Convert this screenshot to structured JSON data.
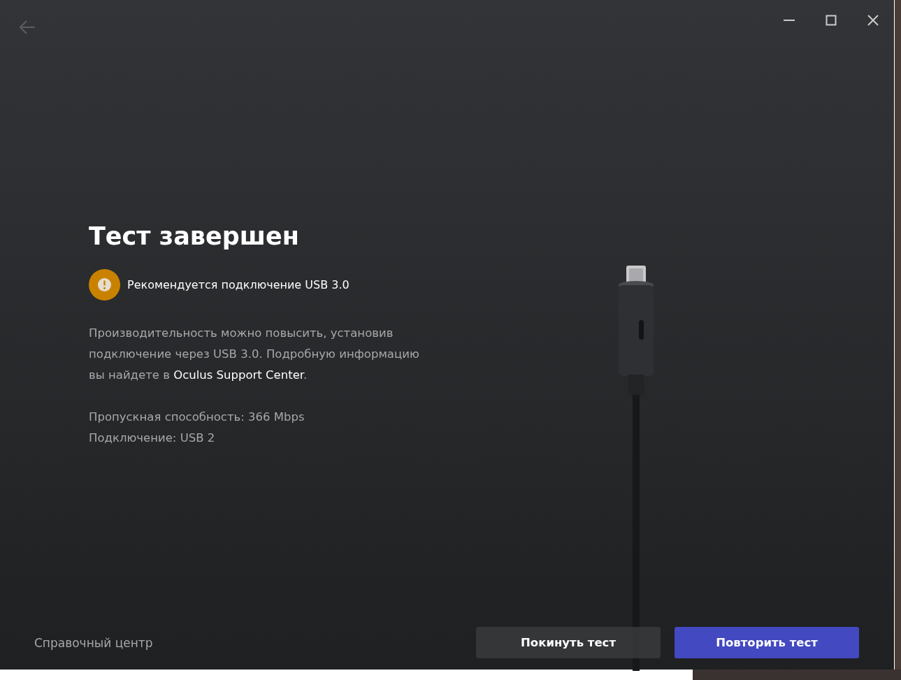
{
  "title": "Тест завершен",
  "notice": {
    "kind": "warning",
    "text": "Рекомендуется подключение USB 3.0"
  },
  "description": {
    "before": "Производительность можно повысить, установив подключение через USB 3.0. Подробную информацию вы найдете в ",
    "link": "Oculus Support Center",
    "after": "."
  },
  "stats": [
    "Пропускная способность: 366 Mbps",
    "Подключение: USB 2"
  ],
  "footer": {
    "help_link": "Справочный центр",
    "buttons": [
      {
        "label": "Покинуть тест",
        "kind": "secondary"
      },
      {
        "label": "Повторить тест",
        "kind": "primary"
      }
    ]
  }
}
